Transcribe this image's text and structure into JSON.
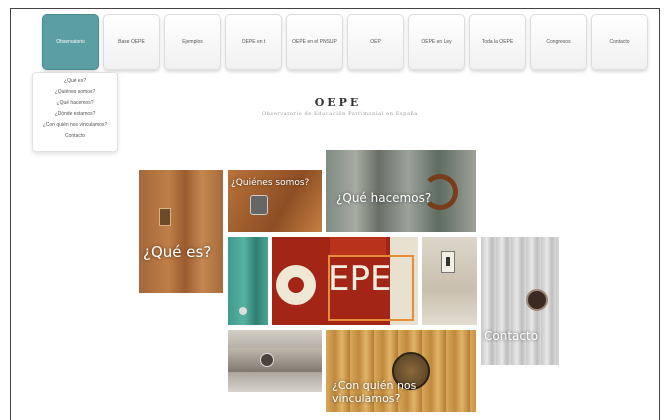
{
  "nav": {
    "items": [
      {
        "label": "Observatorio",
        "active": true
      },
      {
        "label": "Base OEPE",
        "active": false
      },
      {
        "label": "Ejemplos",
        "active": false
      },
      {
        "label": "OEPE en t",
        "active": false
      },
      {
        "label": "OEPE en el PNSUP",
        "active": false
      },
      {
        "label": "OEP",
        "active": false
      },
      {
        "label": "OEPE en Ley",
        "active": false
      },
      {
        "label": "Toda la OEPE",
        "active": false
      },
      {
        "label": "Congresos",
        "active": false
      },
      {
        "label": "Contacto",
        "active": false
      }
    ]
  },
  "dropdown": {
    "items": [
      "¿Qué es?",
      "¿Quiénes somos?",
      "¿Qué hacemos?",
      "¿Dónde estamos?",
      "¿Con quién nos vinculamos?",
      "Contacto"
    ]
  },
  "header": {
    "title": "OEPE",
    "subtitle": "Observatorio de Educación Patrimonial en España"
  },
  "tiles": {
    "que_es": "¿Qué es?",
    "quienes_somos": "¿Quiénes somos?",
    "que_hacemos": "¿Qué hacemos?",
    "logo_text": "EPE",
    "contacto": "Contacto",
    "con_quien": "¿Con quién nos vinculamos?"
  },
  "colors": {
    "accent": "#5b9ea3",
    "logo_red": "#a32516",
    "logo_orange": "#e58d3a"
  }
}
